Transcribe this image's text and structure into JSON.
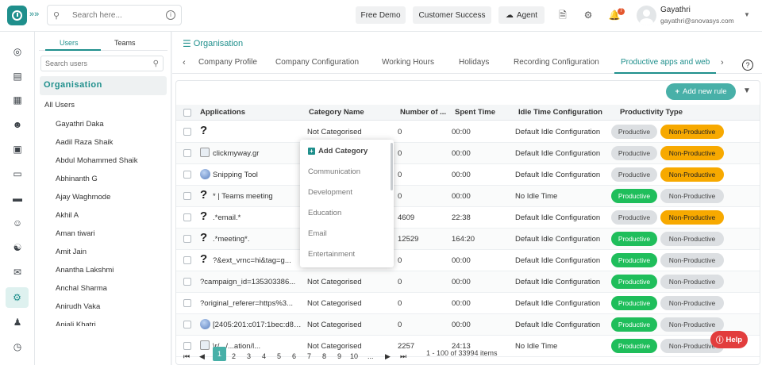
{
  "header": {
    "search_placeholder": "Search here...",
    "free_demo": "Free Demo",
    "customer_success": "Customer Success",
    "agent": "Agent",
    "notification_count": "7",
    "user_name": "Gayathri",
    "user_email": "gayathri@snovasys.com",
    "expand_glyph": "»»"
  },
  "user_panel": {
    "tabs": [
      "Users",
      "Teams"
    ],
    "active_tab": "Users",
    "search_placeholder": "Search users",
    "org_label": "Organisation",
    "all_users": "All Users",
    "users": [
      "Gayathri Daka",
      "Aadil Raza Shaik",
      "Abdul Mohammed Shaik",
      "Abhinanth G",
      "Ajay Waghmode",
      "Akhil A",
      "Aman tiwari",
      "Amit Jain",
      "Anantha Lakshmi",
      "Anchal Sharma",
      "Anirudh Vaka",
      "Anjali Khatri"
    ]
  },
  "main": {
    "breadcrumb": "Organisation",
    "tabs": [
      "Company Profile",
      "Company Configuration",
      "Working Hours",
      "Holidays",
      "Recording Configuration",
      "Productive apps and web"
    ],
    "active_tab": "Productive apps and web",
    "add_rule": "Add new rule",
    "columns": [
      "Applications",
      "Category Name",
      "Number of ...",
      "Spent Time",
      "Idle Time Configuration",
      "Productivity Type"
    ],
    "rows": [
      {
        "icon": "question",
        "app": "",
        "category": "Not Categorised",
        "number": "0",
        "spent": "00:00",
        "idle": "Default Idle Configuration",
        "type": "non-productive"
      },
      {
        "icon": "image",
        "app": "clickmyway.gr",
        "category": "",
        "number": "0",
        "spent": "00:00",
        "idle": "Default Idle Configuration",
        "type": "non-productive"
      },
      {
        "icon": "globe",
        "app": "Snipping Tool",
        "category": "",
        "number": "0",
        "spent": "00:00",
        "idle": "Default Idle Configuration",
        "type": "non-productive"
      },
      {
        "icon": "question",
        "app": "* | Teams meeting",
        "category": "",
        "number": "0",
        "spent": "00:00",
        "idle": "No Idle Time",
        "type": "productive"
      },
      {
        "icon": "question",
        "app": ".*email.*",
        "category": "",
        "number": "4609",
        "spent": "22:38",
        "idle": "Default Idle Configuration",
        "type": "non-productive"
      },
      {
        "icon": "question",
        "app": ".*meeting*.",
        "category": "",
        "number": "12529",
        "spent": "164:20",
        "idle": "Default Idle Configuration",
        "type": "productive"
      },
      {
        "icon": "question",
        "app": "?&ext_vrnc=hi&tag=g...",
        "category": "",
        "number": "0",
        "spent": "00:00",
        "idle": "Default Idle Configuration",
        "type": "productive"
      },
      {
        "icon": "none",
        "app": "?campaign_id=135303386...",
        "category": "Not Categorised",
        "number": "0",
        "spent": "00:00",
        "idle": "Default Idle Configuration",
        "type": "productive"
      },
      {
        "icon": "none",
        "app": "?original_referer=https%3...",
        "category": "Not Categorised",
        "number": "0",
        "spent": "00:00",
        "idle": "Default Idle Configuration",
        "type": "productive"
      },
      {
        "icon": "globe",
        "app": "[2405:201:c017:1bec:d8a...",
        "category": "Not Categorised",
        "number": "0",
        "spent": "00:00",
        "idle": "Default Idle Configuration",
        "type": "productive"
      },
      {
        "icon": "image",
        "app": "\\r/.../...ation/l...",
        "category": "Not Categorised",
        "number": "2257",
        "spent": "24:13",
        "idle": "No Idle Time",
        "type": "productive"
      }
    ],
    "productive_label": "Productive",
    "non_productive_label": "Non-Productive",
    "dropdown": {
      "add_category": "Add Category",
      "items": [
        "Communication",
        "Development",
        "Education",
        "Email",
        "Entertainment"
      ]
    },
    "pagination": {
      "pages": [
        "1",
        "2",
        "3",
        "4",
        "5",
        "6",
        "7",
        "8",
        "9",
        "10",
        "..."
      ],
      "current": "1",
      "info": "1 - 100 of 33994 items"
    },
    "help": "Help"
  },
  "colors": {
    "brand": "#1f8f8c",
    "productive_on": "#1fbe5b",
    "non_productive_on": "#f7a900",
    "help": "#e23d3d"
  }
}
